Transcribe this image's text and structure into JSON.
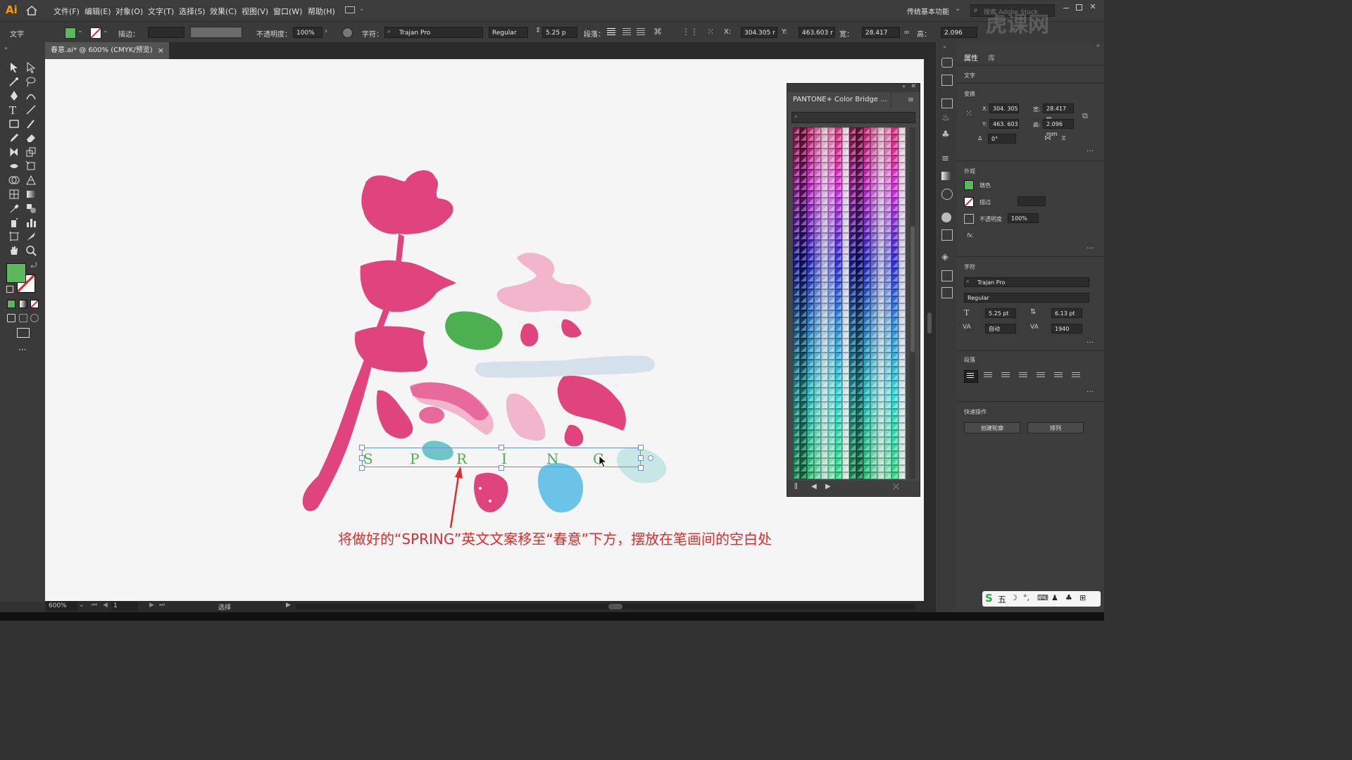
{
  "app": {
    "logo": "Ai",
    "menu": [
      "文件(F)",
      "编辑(E)",
      "对象(O)",
      "文字(T)",
      "选择(S)",
      "效果(C)",
      "视图(V)",
      "窗口(W)",
      "帮助(H)"
    ],
    "workspace": "传统基本功能",
    "search_placeholder": "搜索 Adobe Stock"
  },
  "control_bar": {
    "tool_name": "文字",
    "stroke_label": "描边：",
    "opacity_label": "不透明度：",
    "opacity_value": "100%",
    "char_label": "字符：",
    "font_family": "Trajan Pro",
    "font_style": "Regular",
    "font_size": "5.25 p",
    "paragraph_label": "段落：",
    "x_label": "X:",
    "x_value": "304.305 r",
    "y_label": "Y:",
    "y_value": "463.603 r",
    "w_label": "宽：",
    "w_value": "28.417 mm",
    "h_label": "高：",
    "h_value": "2.096 mm"
  },
  "document_tab": {
    "title": "春意.ai* @ 600% (CMYK/预览)",
    "close": "×"
  },
  "canvas": {
    "spring_letters": [
      "S",
      "P",
      "R",
      "I",
      "N",
      "G"
    ],
    "annotation": "将做好的“SPRING”英文文案移至“春意”下方，摆放在笔画间的空白处",
    "colors": {
      "deep_pink": "#e0447c",
      "light_pink": "#f2b6cc",
      "green": "#4caf50",
      "pale_blue": "#d5e1ea",
      "sky_blue": "#6cc3e8",
      "teal": "#6ec6c6",
      "text_green": "#4fae59",
      "annotation_red": "#e22a2a"
    }
  },
  "pantone_panel": {
    "title": "PANTONE+ Color Bridge ...",
    "search_placeholder": ""
  },
  "properties_panel": {
    "tabs": [
      "属性",
      "库"
    ],
    "section_text": "文字",
    "section_transform": "变换",
    "x_label": "X:",
    "x_value": "304. 305",
    "w_label": "宽:",
    "w_value": "28.417 m",
    "y_label": "Y:",
    "y_value": "463. 603",
    "h_label": "高:",
    "h_value": "2.096 mm",
    "angle_label": "∆",
    "angle_value": "0°",
    "section_appearance": "外观",
    "fill_label": "填色",
    "stroke_label": "描边",
    "opacity_label": "不透明度",
    "opacity_value": "100%",
    "fx_label": "fx.",
    "section_character": "字符",
    "font_family": "Trajan Pro",
    "font_style": "Regular",
    "font_size": "5.25 pt",
    "leading": "6.13 pt",
    "kerning": "自动",
    "tracking": "1940",
    "section_paragraph": "段落",
    "section_quick": "快速操作",
    "btn_outline": "创建轮廓",
    "btn_arrange": "排列"
  },
  "status_bar": {
    "zoom": "600%",
    "artboard": "1",
    "tool": "选择"
  },
  "ime": {
    "label": "五"
  },
  "watermark": "虎课网"
}
